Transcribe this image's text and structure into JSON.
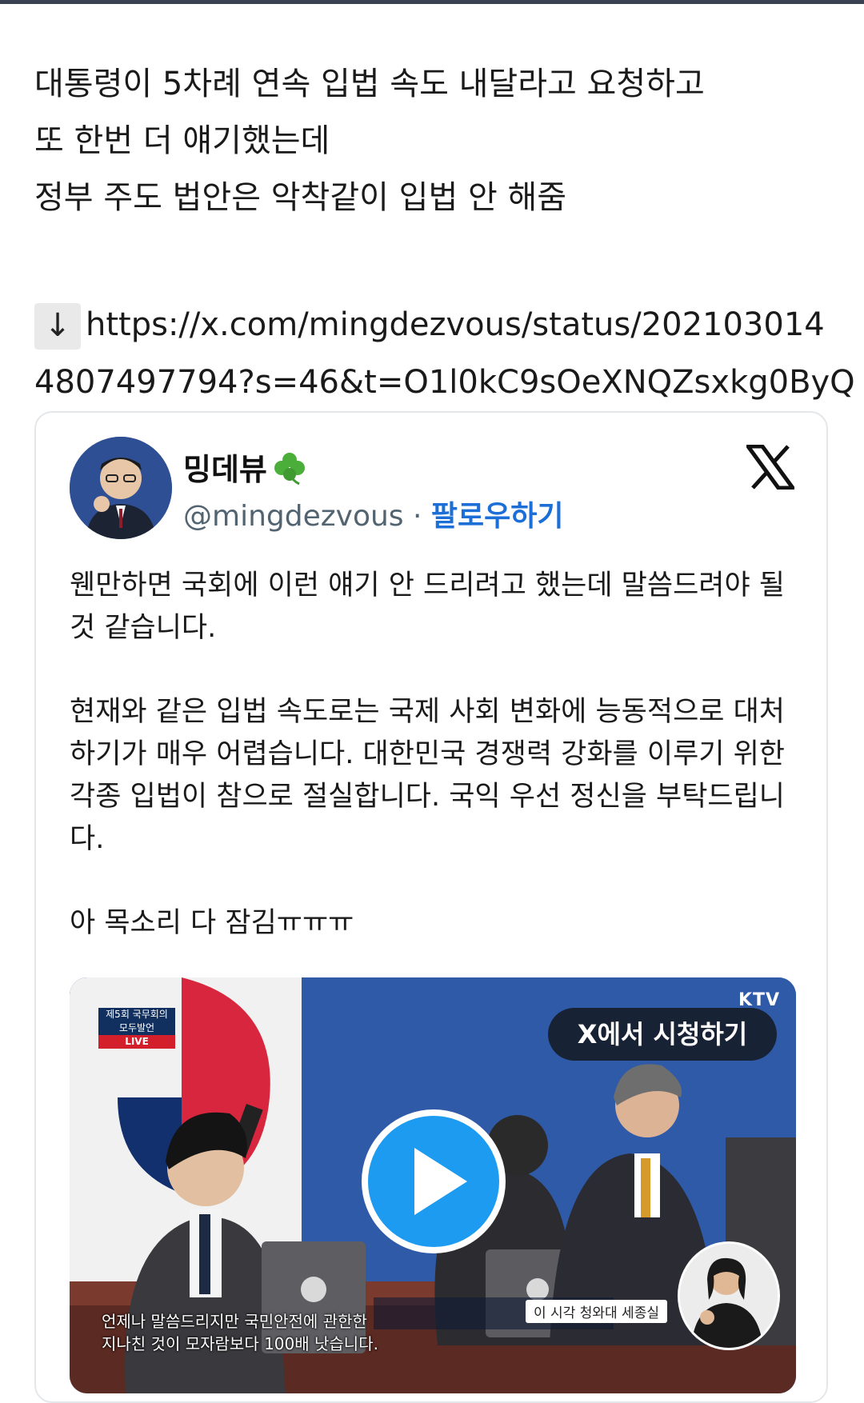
{
  "post": {
    "lines": [
      "대통령이 5차례 연속 입법 속도 내달라고 요청하고",
      "또 한번 더 얘기했는데",
      "정부 주도 법안은 악착같이 입법 안 해줌"
    ],
    "link_icon": "↓",
    "link_line1": "https://x.com/mingdezvous/status/202103014",
    "link_line2": "4807497794?s=46&t=O1l0kC9sOeXNQZsxkg0ByQ"
  },
  "embed": {
    "author_name": "밍데뷰",
    "author_handle": "@mingdezvous",
    "separator": "·",
    "follow_label": "팔로우하기",
    "paragraphs": [
      "웬만하면 국회에 이런 얘기 안 드리려고 했는데 말씀드려야 될 것 같습니다.",
      "현재와 같은 입법 속도로는 국제 사회 변화에 능동적으로 대처하기가 매우 어렵습니다. 대한민국 경쟁력 강화를 이루기 위한 각종 입법이 참으로 절실합니다. 국익 우선 정신을 부탁드립니다.",
      "아 목소리 다 잠김ㅠㅠㅠ"
    ],
    "media": {
      "watch_label": "X에서 시청하기",
      "channel": "KTV",
      "tag_line1": "제5회 국무회의",
      "tag_line2": "모두발언",
      "tag_live": "LIVE",
      "subtitle_line1": "언제나 말씀드리지만 국민안전에 관한한",
      "subtitle_line2": "지나친 것이 모자람보다 100배 낫습니다.",
      "caption": "이 시각 청와대 세종실"
    }
  },
  "colors": {
    "follow": "#1d6fd8",
    "handle": "#536471",
    "play": "#1d9bf0"
  }
}
